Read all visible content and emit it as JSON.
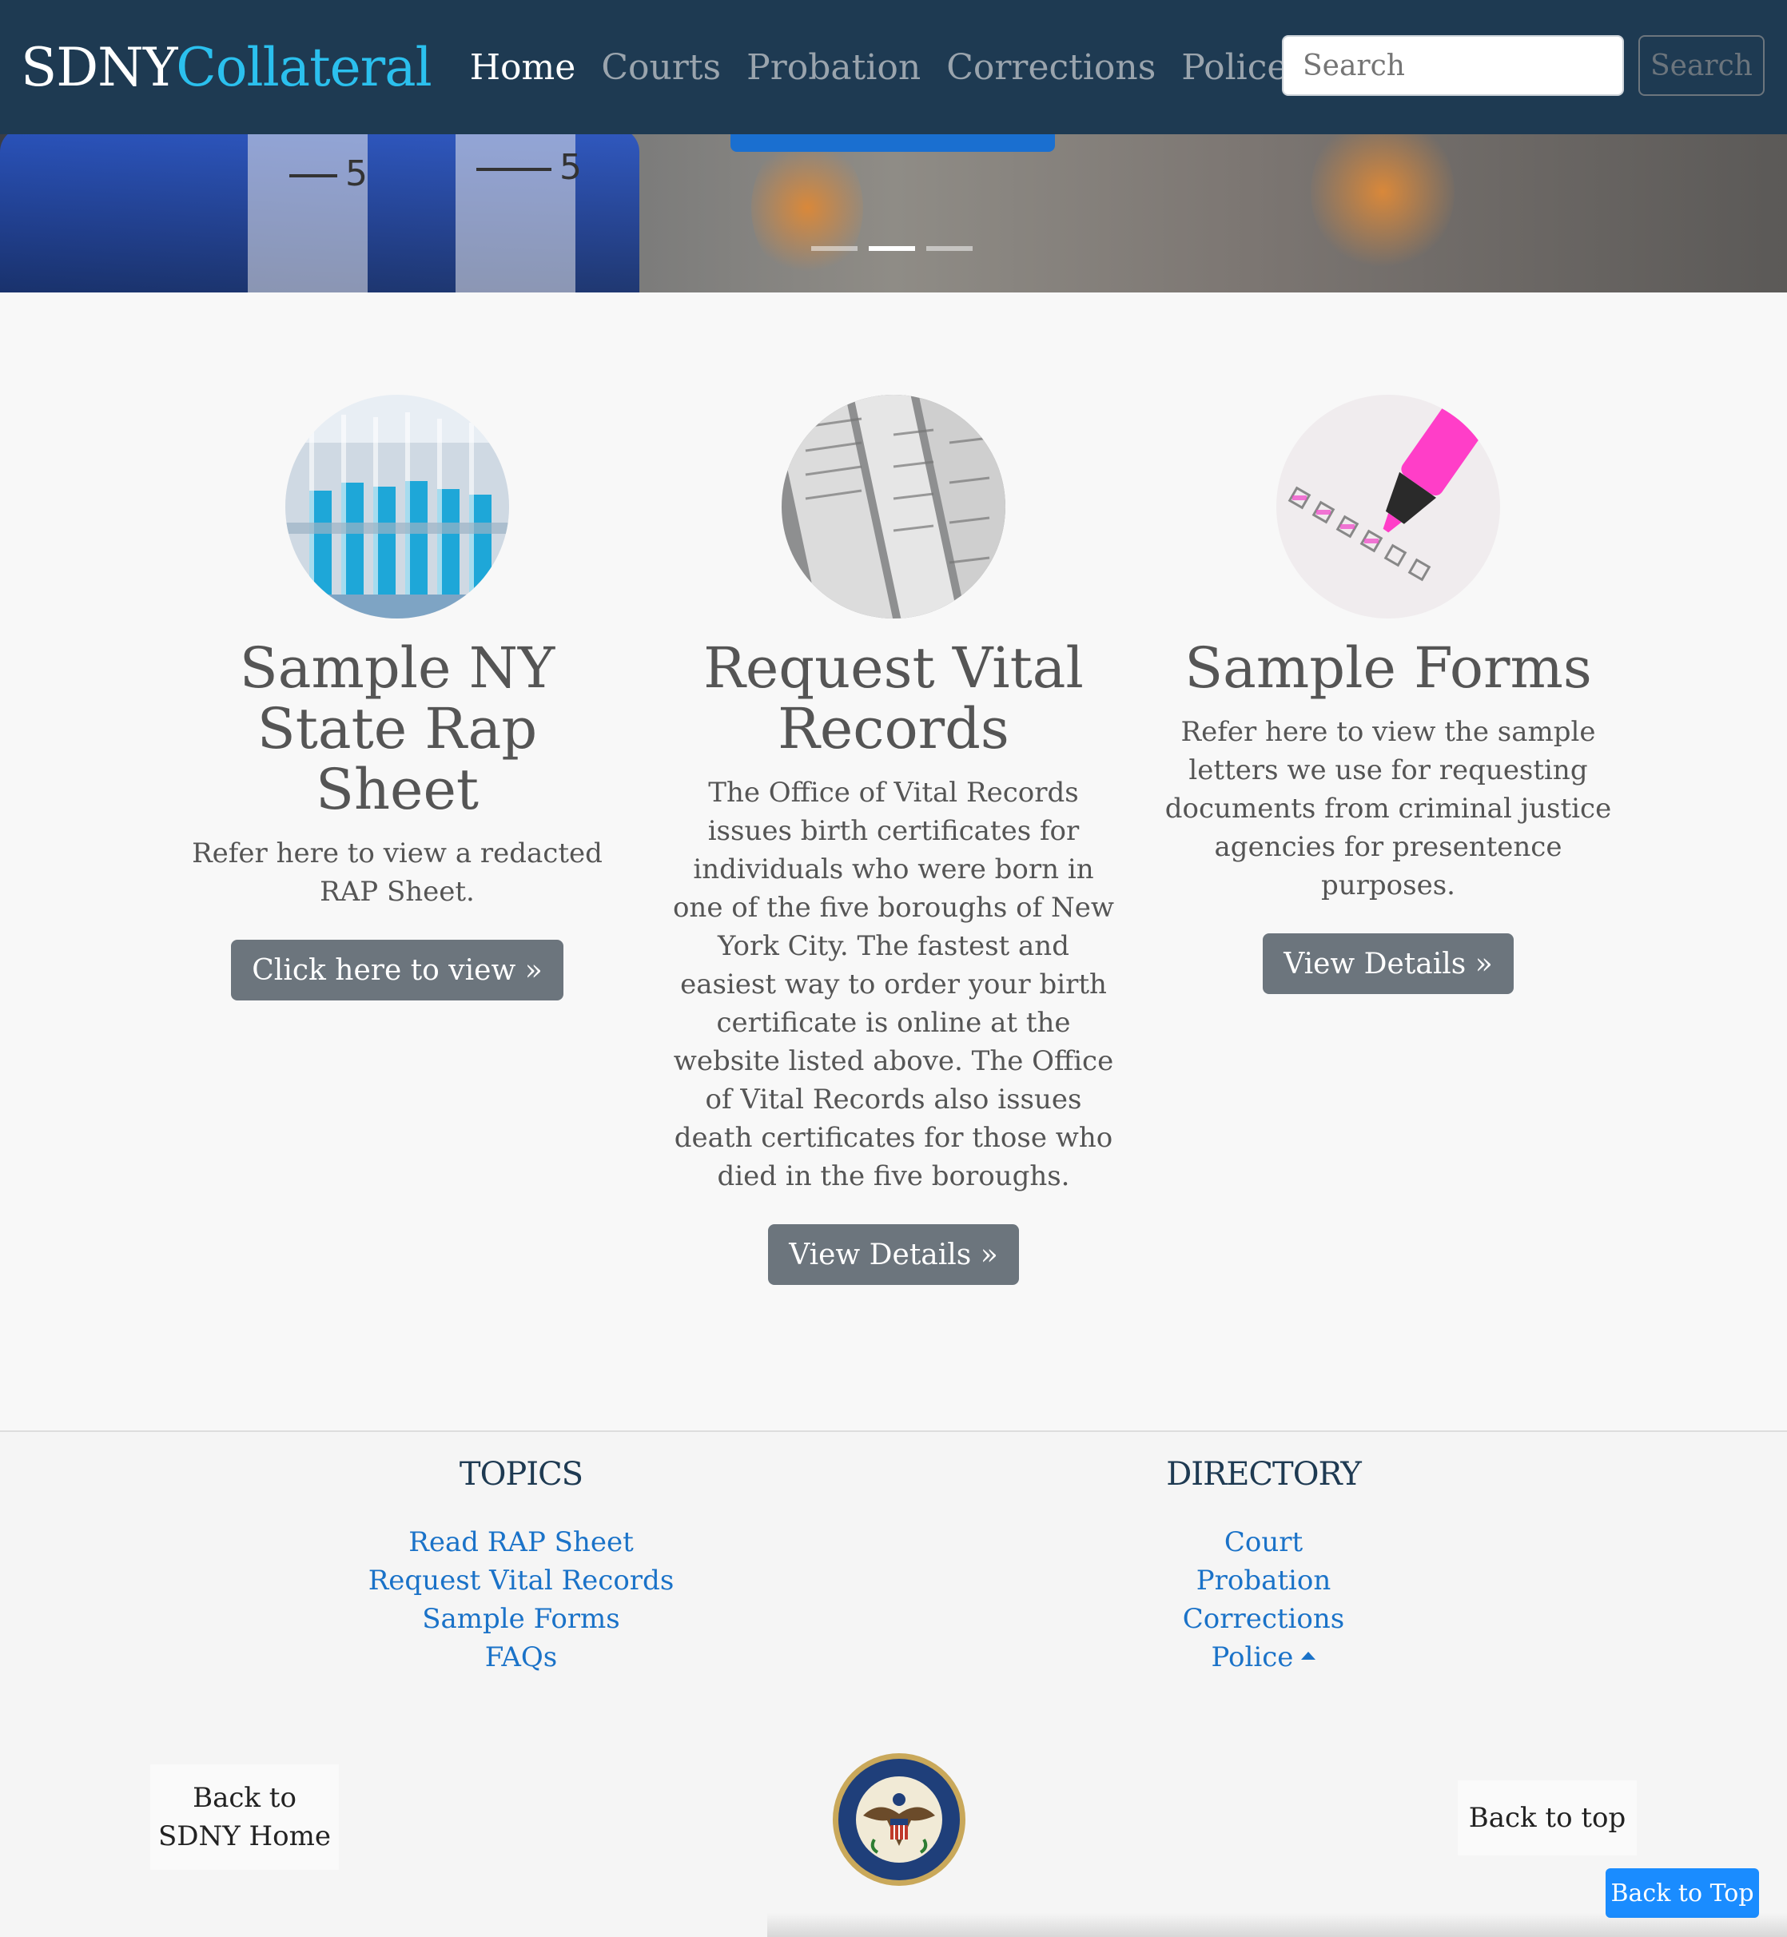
{
  "navbar": {
    "brand_main": "SDNY",
    "brand_accent": "Collateral",
    "links": [
      {
        "label": "Home",
        "active": true
      },
      {
        "label": "Courts",
        "active": false
      },
      {
        "label": "Probation",
        "active": false
      },
      {
        "label": "Corrections",
        "active": false
      },
      {
        "label": "Police",
        "active": false,
        "dropdown": true
      }
    ],
    "search": {
      "placeholder": "Search",
      "button_label": "Search"
    }
  },
  "hero": {
    "slides": 3,
    "active_slide": 2,
    "scale_marks": [
      "5",
      "5"
    ]
  },
  "features": [
    {
      "image": "test-tubes-image",
      "title": "Sample NY State Rap Sheet",
      "text": "Refer here to view a redacted RAP Sheet.",
      "button_label": "Click here to view »"
    },
    {
      "image": "documents-image",
      "title": "Request Vital Records",
      "text": "The Office of Vital Records issues birth certificates for individuals who were born in one of the five boroughs of New York City. The fastest and easiest way to order your birth certificate is online at the website listed above. The Office of Vital Records also issues death certificates for those who died in the five boroughs.",
      "button_label": "View Details »"
    },
    {
      "image": "highlighter-checklist-image",
      "title": "Sample Forms",
      "text": "Refer here to view the sample letters we use for requesting documents from criminal justice agencies for presentence purposes.",
      "button_label": "View Details »"
    }
  ],
  "footer": {
    "topics": {
      "heading": "TOPICS",
      "links": [
        "Read RAP Sheet",
        "Request Vital Records",
        "Sample Forms",
        "FAQs"
      ]
    },
    "directory": {
      "heading": "DIRECTORY",
      "links": [
        "Court",
        "Probation",
        "Corrections",
        "Police"
      ]
    },
    "back_home_line1": "Back to",
    "back_home_line2": "SDNY Home",
    "back_to_top_text": "Back to top",
    "back_to_top_button": "Back to Top",
    "seal_text": "UNITED STATES PROBATION · SOUTHERN DISTRICT OF NEW YORK"
  },
  "colors": {
    "navbar_bg": "#1e3a52",
    "brand_accent": "#2bc0ee",
    "link": "#1a72c8",
    "secondary_button": "#6c757d",
    "primary_button": "#1a8cff"
  }
}
